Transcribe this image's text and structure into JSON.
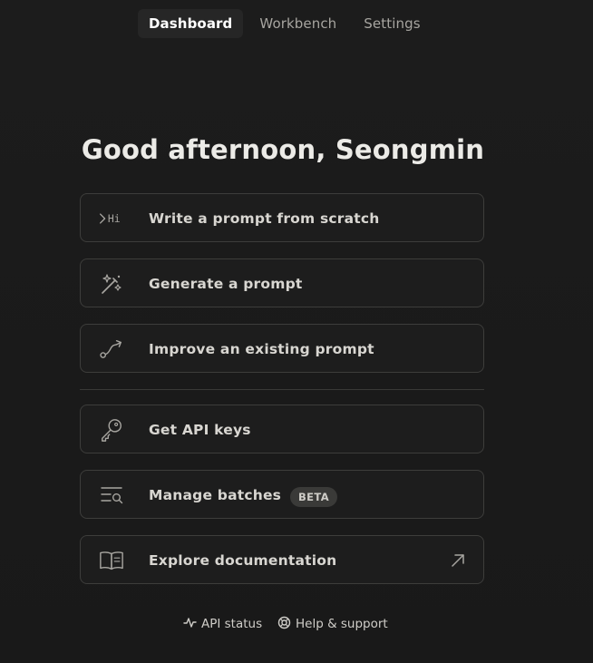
{
  "nav": {
    "tabs": [
      {
        "label": "Dashboard",
        "active": true
      },
      {
        "label": "Workbench",
        "active": false
      },
      {
        "label": "Settings",
        "active": false
      }
    ]
  },
  "greeting": "Good afternoon, Seongmin",
  "actions": [
    {
      "label": "Write a prompt from scratch",
      "icon": "terminal-hi-icon",
      "icon_text": "Hi"
    },
    {
      "label": "Generate a prompt",
      "icon": "magic-wand-icon"
    },
    {
      "label": "Improve an existing prompt",
      "icon": "path-arrow-icon"
    }
  ],
  "resources": [
    {
      "label": "Get API keys",
      "icon": "key-icon"
    },
    {
      "label": "Manage batches",
      "icon": "batch-search-icon",
      "badge": "BETA"
    },
    {
      "label": "Explore documentation",
      "icon": "book-icon",
      "external_icon": "external-arrow-icon"
    }
  ],
  "footer": {
    "api_status": "API status",
    "help_support": "Help & support"
  },
  "colors": {
    "background": "#1c1c1c",
    "card_border": "#3d3d3b",
    "active_tab": "#262626",
    "text_primary": "#ecebe7",
    "text_muted": "#a7a5a0"
  }
}
